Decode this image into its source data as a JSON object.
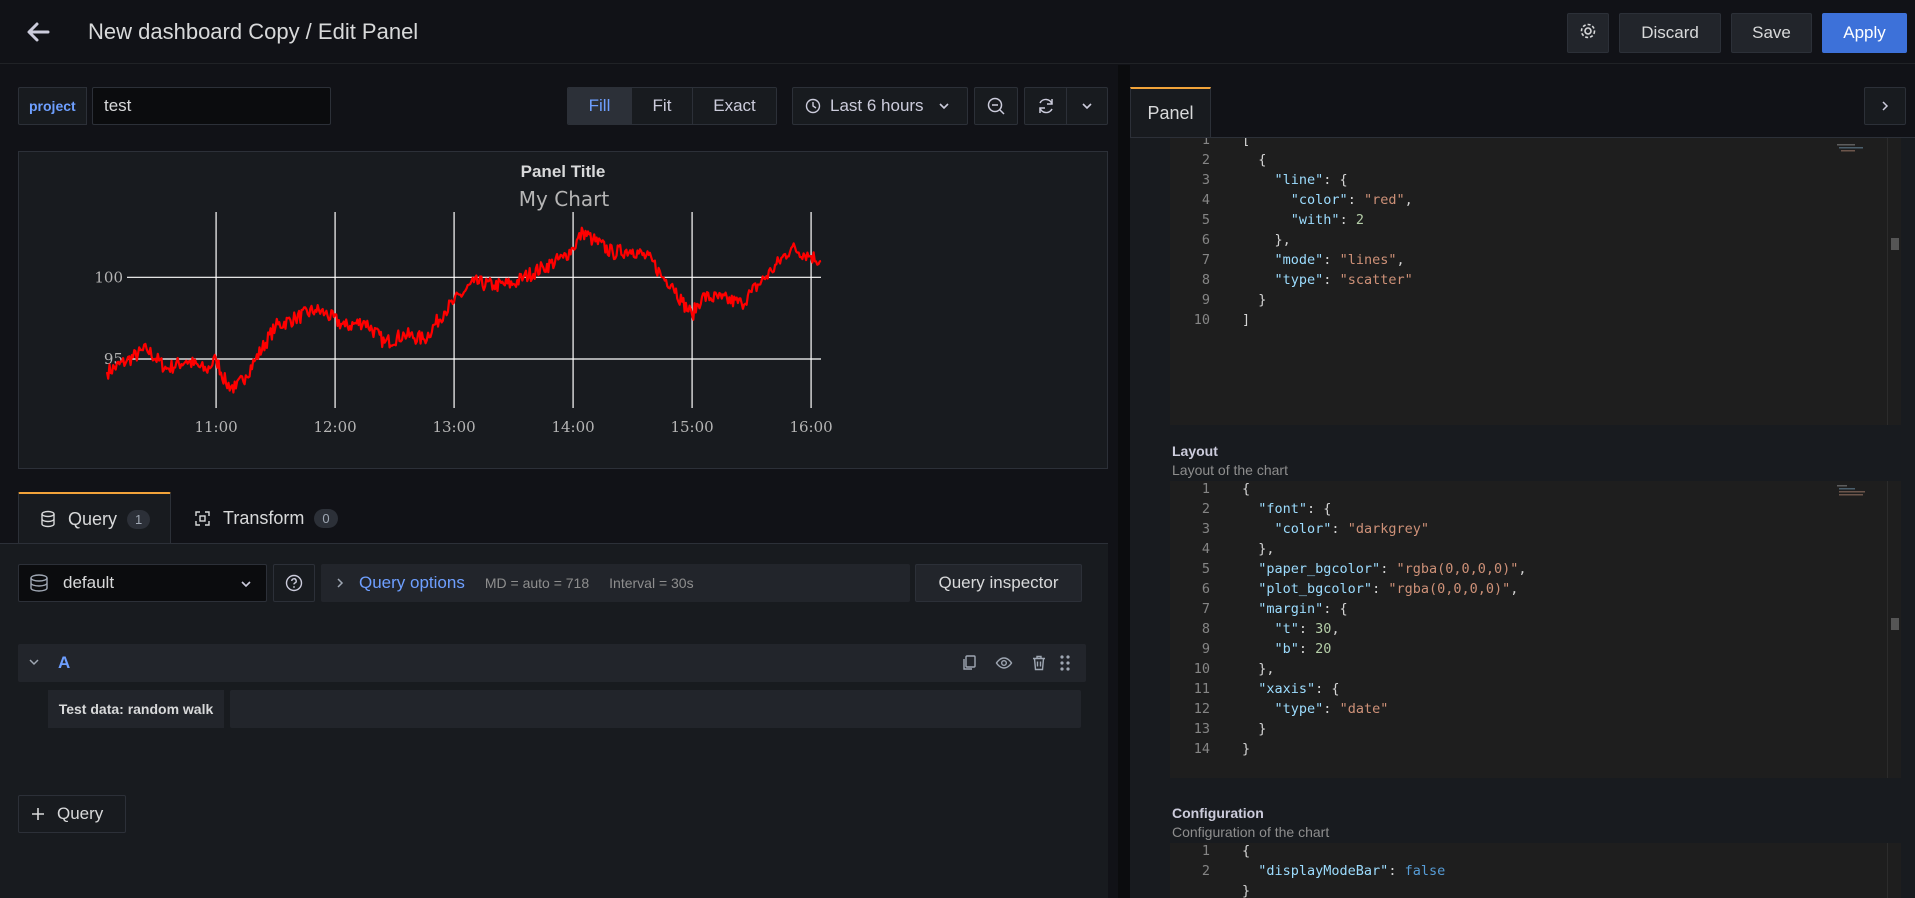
{
  "header": {
    "title": "New dashboard Copy / Edit Panel",
    "discard_label": "Discard",
    "save_label": "Save",
    "apply_label": "Apply"
  },
  "variables": {
    "label": "project",
    "value": "test"
  },
  "toolbar": {
    "view_modes": [
      "Fill",
      "Fit",
      "Exact"
    ],
    "active_mode": "Fill",
    "time_range": "Last 6 hours"
  },
  "panel": {
    "title": "Panel Title"
  },
  "chart_data": {
    "type": "line",
    "title": "My Chart",
    "xlabel": "",
    "ylabel": "",
    "x_ticks": [
      "11:00",
      "12:00",
      "13:00",
      "14:00",
      "15:00",
      "16:00"
    ],
    "y_ticks": [
      95,
      100
    ],
    "xlim": [
      "10:05",
      "16:05"
    ],
    "ylim": [
      92,
      104
    ],
    "series": [
      {
        "color": "#ff0000",
        "x": [
          "10:05",
          "10:15",
          "10:25",
          "10:35",
          "10:45",
          "10:55",
          "11:00",
          "11:05",
          "11:10",
          "11:15",
          "11:20",
          "11:30",
          "11:40",
          "11:50",
          "11:55",
          "12:05",
          "12:15",
          "12:25",
          "12:35",
          "12:45",
          "12:55",
          "13:00",
          "13:10",
          "13:20",
          "13:30",
          "13:35",
          "13:45",
          "13:55",
          "14:00",
          "14:05",
          "14:10",
          "14:20",
          "14:30",
          "14:40",
          "14:45",
          "14:50",
          "14:55",
          "15:00",
          "15:05",
          "15:15",
          "15:25",
          "15:30",
          "15:40",
          "15:50",
          "16:00",
          "16:05"
        ],
        "values": [
          94.2,
          94.9,
          95.6,
          94.4,
          94.9,
          94.3,
          95.0,
          93.5,
          93.2,
          94.0,
          95.0,
          97.0,
          97.5,
          98.0,
          97.8,
          97.0,
          97.3,
          96.0,
          96.5,
          96.2,
          97.9,
          98.5,
          99.7,
          99.5,
          99.6,
          100.0,
          100.6,
          101.2,
          101.8,
          102.8,
          102.3,
          101.5,
          101.7,
          101.0,
          100.0,
          99.6,
          98.5,
          97.7,
          98.8,
          98.7,
          98.4,
          99.1,
          100.4,
          101.8,
          101.3,
          101.0
        ]
      }
    ]
  },
  "query_tabs": [
    {
      "label": "Query",
      "count": "1"
    },
    {
      "label": "Transform",
      "count": "0"
    }
  ],
  "query": {
    "datasource": "default",
    "options_label": "Query options",
    "md": "MD = auto = 718",
    "interval": "Interval = 30s",
    "inspector_label": "Query inspector",
    "ref_id": "A",
    "scenario": "Test data: random walk",
    "add_label": "Query"
  },
  "options_pane": {
    "tab_label": "Panel",
    "data_lines": [
      "1",
      "2",
      "3",
      "4",
      "5",
      "6",
      "7",
      "8",
      "9",
      "10"
    ],
    "layout": {
      "title": "Layout",
      "description": "Layout of the chart",
      "lines": [
        "1",
        "2",
        "3",
        "4",
        "5",
        "6",
        "7",
        "8",
        "9",
        "10",
        "11",
        "12",
        "13",
        "14"
      ]
    },
    "config": {
      "title": "Configuration",
      "description": "Configuration of the chart",
      "lines": [
        "1",
        "2"
      ]
    }
  }
}
